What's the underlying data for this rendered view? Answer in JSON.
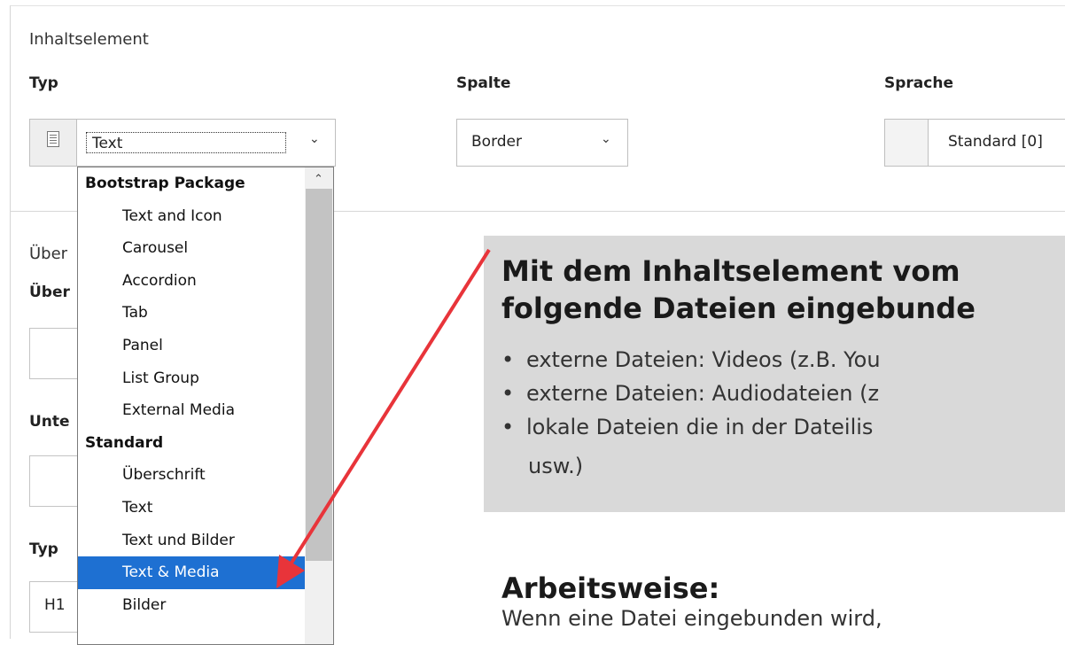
{
  "form": {
    "section_title": "Inhaltselement",
    "typ_label": "Typ",
    "typ_value": "Text",
    "spalte_label": "Spalte",
    "spalte_value": "Border",
    "sprache_label": "Sprache",
    "sprache_value": "Standard [0]",
    "lower": {
      "ueber_normal": "Über",
      "ueber_bold": "Über",
      "unte_bold": "Unte",
      "typ_bold": "Typ",
      "typ_value": "H1"
    }
  },
  "dropdown": {
    "items": [
      {
        "label": "Bootstrap Package",
        "group": true
      },
      {
        "label": "Text and Icon"
      },
      {
        "label": "Carousel"
      },
      {
        "label": "Accordion"
      },
      {
        "label": "Tab"
      },
      {
        "label": "Panel"
      },
      {
        "label": "List Group"
      },
      {
        "label": "External Media"
      },
      {
        "label": "Standard",
        "group": true
      },
      {
        "label": "Überschrift"
      },
      {
        "label": "Text"
      },
      {
        "label": "Text und Bilder"
      },
      {
        "label": "Text & Media",
        "selected": true
      },
      {
        "label": "Bilder"
      }
    ]
  },
  "callout": {
    "heading_line1": "Mit dem Inhaltselement vom",
    "heading_line2": "folgende Dateien eingebunde",
    "bullets": [
      "externe Dateien: Videos (z.B. You",
      "externe Dateien: Audiodateien (z",
      "lokale Dateien die in der Dateilis"
    ],
    "bullet_continuation": "usw.)",
    "bullet_symbol": "•"
  },
  "arbeitsweise": {
    "heading": "Arbeitsweise:",
    "text": "Wenn eine Datei eingebunden wird,"
  },
  "colors": {
    "selection": "#1e70d2",
    "arrow": "#e8343a",
    "callout_bg": "#d9d9d9"
  },
  "icons": {
    "chevron": "⌄",
    "chevron_up": "^"
  }
}
